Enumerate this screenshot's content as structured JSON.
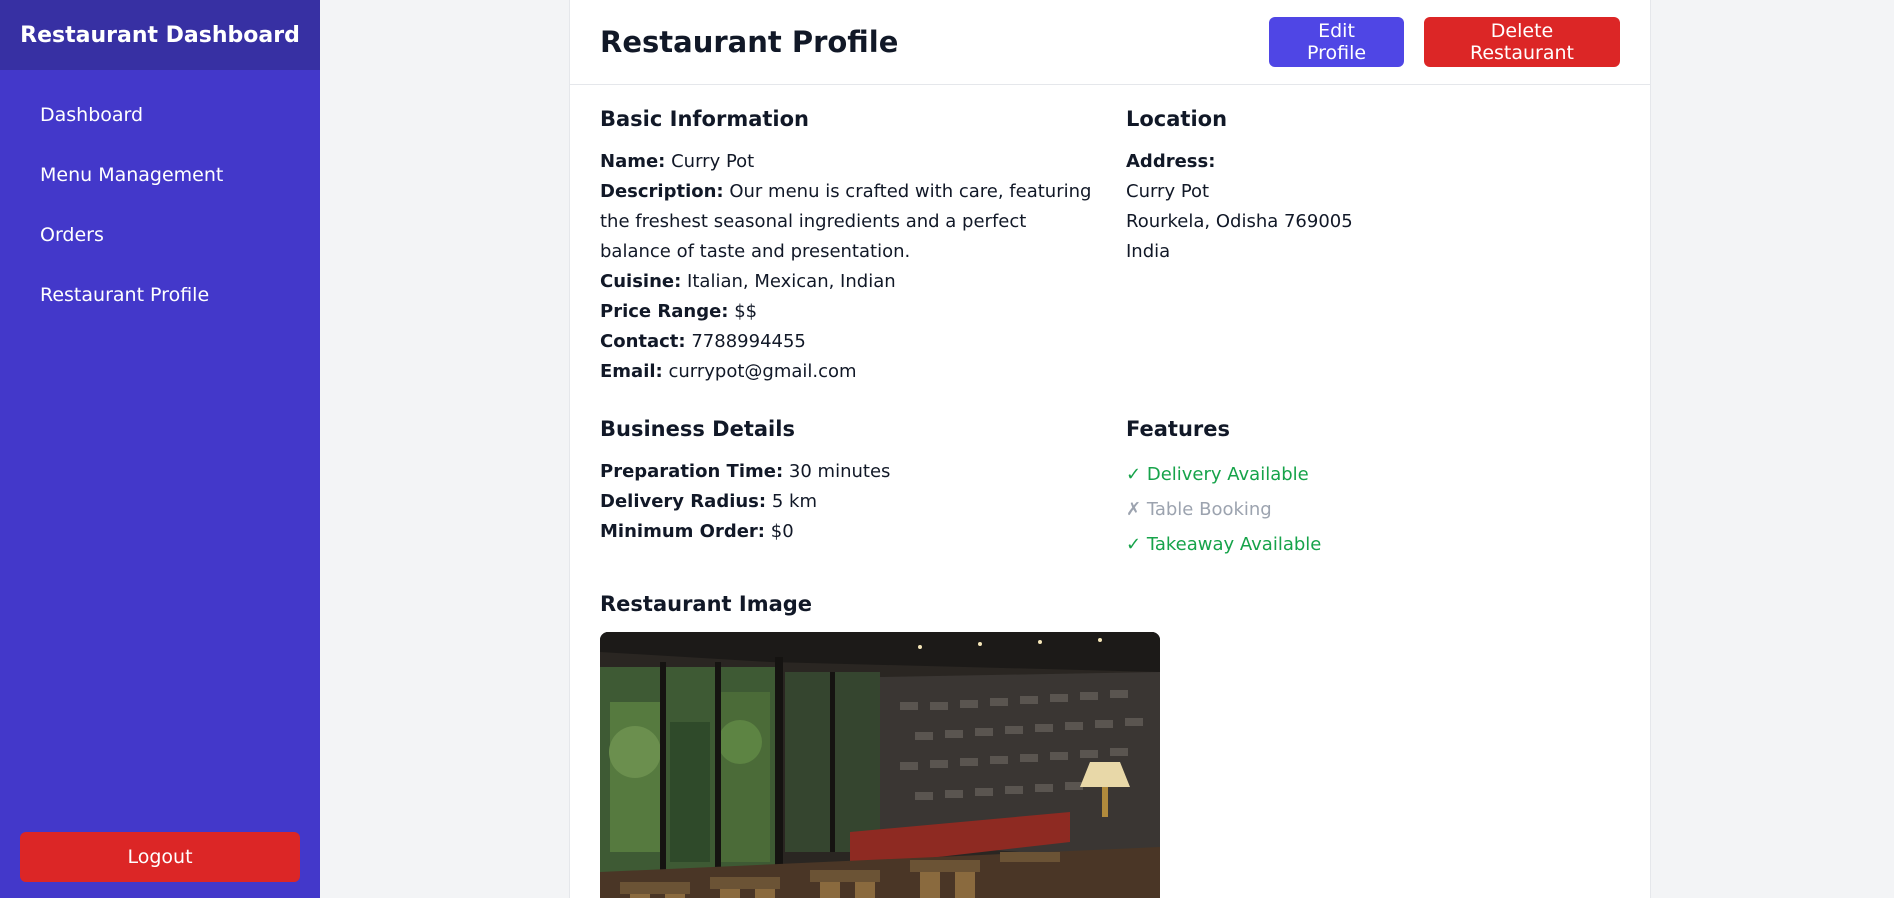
{
  "colors": {
    "sidebar": "#4338ca",
    "sidebar_header": "#3730a3",
    "primary": "#4f46e5",
    "danger": "#dc2626",
    "success": "#16a34a",
    "muted": "#9ca3af"
  },
  "sidebar": {
    "title": "Restaurant Dashboard",
    "items": [
      {
        "label": "Dashboard"
      },
      {
        "label": "Menu Management"
      },
      {
        "label": "Orders"
      },
      {
        "label": "Restaurant Profile"
      }
    ],
    "logout_label": "Logout"
  },
  "header": {
    "title": "Restaurant Profile",
    "edit_label": "Edit Profile",
    "delete_label": "Delete Restaurant"
  },
  "basic_info": {
    "title": "Basic Information",
    "name_label": "Name:",
    "name": "Curry Pot",
    "description_label": "Description:",
    "description": "Our menu is crafted with care, featuring the freshest seasonal ingredients and a perfect balance of taste and presentation.",
    "cuisine_label": "Cuisine:",
    "cuisine": "Italian, Mexican, Indian",
    "price_label": "Price Range:",
    "price": "$$",
    "contact_label": "Contact:",
    "contact": "7788994455",
    "email_label": "Email:",
    "email": "currypot@gmail.com"
  },
  "location": {
    "title": "Location",
    "address_label": "Address:",
    "lines": [
      "Curry Pot",
      "Rourkela, Odisha 769005",
      "India"
    ]
  },
  "business": {
    "title": "Business Details",
    "prep_label": "Preparation Time:",
    "prep": "30 minutes",
    "radius_label": "Delivery Radius:",
    "radius": "5 km",
    "min_label": "Minimum Order:",
    "min": "$0"
  },
  "features": {
    "title": "Features",
    "items": [
      {
        "mark": "✓",
        "label": "Delivery Available",
        "enabled": true
      },
      {
        "mark": "✗",
        "label": "Table Booking",
        "enabled": false
      },
      {
        "mark": "✓",
        "label": "Takeaway Available",
        "enabled": true
      }
    ]
  },
  "image_section": {
    "title": "Restaurant Image"
  }
}
